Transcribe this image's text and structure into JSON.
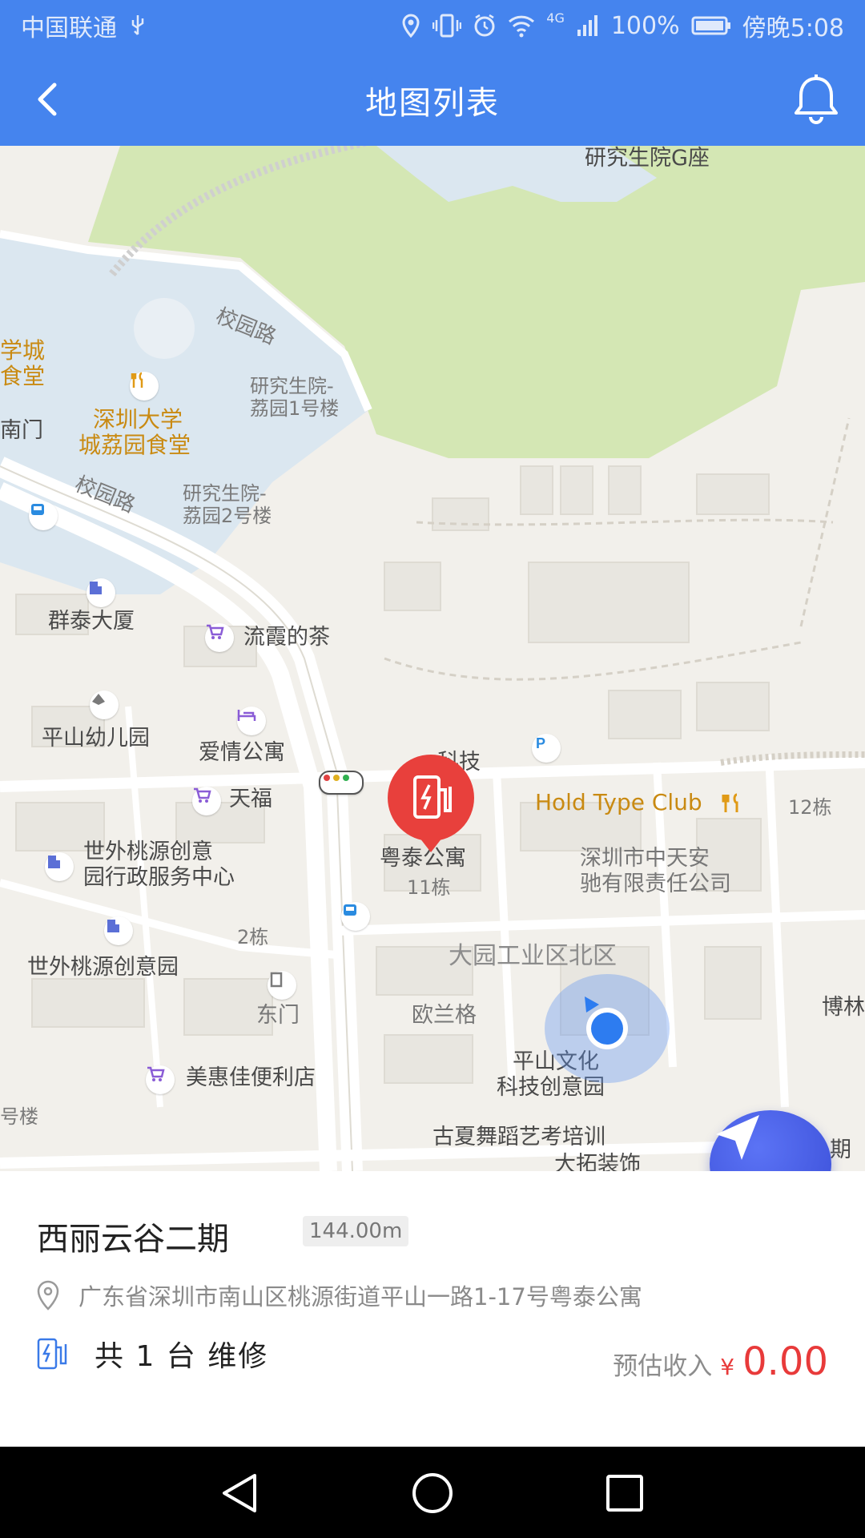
{
  "status_bar": {
    "carrier": "中国联通",
    "network": "4G",
    "battery": "100%",
    "time": "傍晚5:08"
  },
  "app_bar": {
    "title": "地图列表"
  },
  "map": {
    "labels": {
      "grad_g": "研究生院G座",
      "campus_road_1": "校园路",
      "campus_road_2": "校园路",
      "canteen_left_1": "学城",
      "canteen_left_2": "食堂",
      "south_gate": "南门",
      "szu_canteen_1": "深圳大学",
      "szu_canteen_2": "城荔园食堂",
      "grad_1_a": "研究生院-",
      "grad_1_b": "荔园1号楼",
      "grad_2_a": "研究生院-",
      "grad_2_b": "荔园2号楼",
      "quntai": "群泰大厦",
      "liuxia": "流霞的茶",
      "kindergarten": "平山幼儿园",
      "aiqing": "爱情公寓",
      "tech": "科技",
      "tianfu": "天福",
      "hold_type": "Hold Type Club",
      "bldg_12": "12栋",
      "yuetai": "粤泰公寓",
      "bldg_11": "11栋",
      "shiwai_center_1": "世外桃源创意",
      "shiwai_center_2": "园行政服务中心",
      "zhongtian_1": "深圳市中天安",
      "zhongtian_2": "驰有限责任公司",
      "bldg_2": "2栋",
      "dayuan": "大园工业区北区",
      "shiwai_park": "世外桃源创意园",
      "east_gate": "东门",
      "oulange": "欧兰格",
      "bo": "博林",
      "pingshan_1": "平山文化",
      "pingshan_2": "科技创意园",
      "meihuijia": "美惠佳便利店",
      "guxia": "古夏舞蹈艺考培训",
      "dahuan": "大拓装饰",
      "period": "期",
      "lou": "号楼"
    }
  },
  "station": {
    "name": "西丽云谷二期",
    "distance": "144.00m",
    "address": "广东省深圳市南山区桃源街道平山一路1-17号粤泰公寓",
    "count_text": "共 1 台 维修",
    "income_label": "预估收入",
    "income_currency": "¥",
    "income_value": "0.00"
  },
  "colors": {
    "primary": "#4584ee",
    "price": "#e83a3a",
    "marker": "#e8403c",
    "fab": "#3b4fd8"
  }
}
